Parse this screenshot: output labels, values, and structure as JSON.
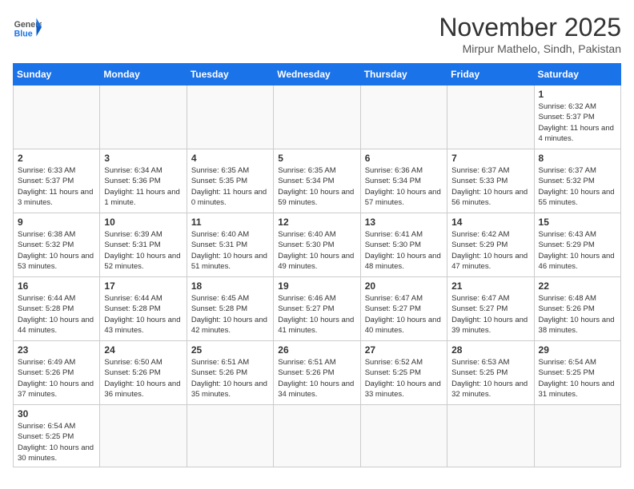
{
  "header": {
    "logo_general": "General",
    "logo_blue": "Blue",
    "month_title": "November 2025",
    "location": "Mirpur Mathelo, Sindh, Pakistan"
  },
  "days_of_week": [
    "Sunday",
    "Monday",
    "Tuesday",
    "Wednesday",
    "Thursday",
    "Friday",
    "Saturday"
  ],
  "weeks": [
    [
      {
        "day": null,
        "info": null
      },
      {
        "day": null,
        "info": null
      },
      {
        "day": null,
        "info": null
      },
      {
        "day": null,
        "info": null
      },
      {
        "day": null,
        "info": null
      },
      {
        "day": null,
        "info": null
      },
      {
        "day": "1",
        "info": "Sunrise: 6:32 AM\nSunset: 5:37 PM\nDaylight: 11 hours and 4 minutes."
      }
    ],
    [
      {
        "day": "2",
        "info": "Sunrise: 6:33 AM\nSunset: 5:37 PM\nDaylight: 11 hours and 3 minutes."
      },
      {
        "day": "3",
        "info": "Sunrise: 6:34 AM\nSunset: 5:36 PM\nDaylight: 11 hours and 1 minute."
      },
      {
        "day": "4",
        "info": "Sunrise: 6:35 AM\nSunset: 5:35 PM\nDaylight: 11 hours and 0 minutes."
      },
      {
        "day": "5",
        "info": "Sunrise: 6:35 AM\nSunset: 5:34 PM\nDaylight: 10 hours and 59 minutes."
      },
      {
        "day": "6",
        "info": "Sunrise: 6:36 AM\nSunset: 5:34 PM\nDaylight: 10 hours and 57 minutes."
      },
      {
        "day": "7",
        "info": "Sunrise: 6:37 AM\nSunset: 5:33 PM\nDaylight: 10 hours and 56 minutes."
      },
      {
        "day": "8",
        "info": "Sunrise: 6:37 AM\nSunset: 5:32 PM\nDaylight: 10 hours and 55 minutes."
      }
    ],
    [
      {
        "day": "9",
        "info": "Sunrise: 6:38 AM\nSunset: 5:32 PM\nDaylight: 10 hours and 53 minutes."
      },
      {
        "day": "10",
        "info": "Sunrise: 6:39 AM\nSunset: 5:31 PM\nDaylight: 10 hours and 52 minutes."
      },
      {
        "day": "11",
        "info": "Sunrise: 6:40 AM\nSunset: 5:31 PM\nDaylight: 10 hours and 51 minutes."
      },
      {
        "day": "12",
        "info": "Sunrise: 6:40 AM\nSunset: 5:30 PM\nDaylight: 10 hours and 49 minutes."
      },
      {
        "day": "13",
        "info": "Sunrise: 6:41 AM\nSunset: 5:30 PM\nDaylight: 10 hours and 48 minutes."
      },
      {
        "day": "14",
        "info": "Sunrise: 6:42 AM\nSunset: 5:29 PM\nDaylight: 10 hours and 47 minutes."
      },
      {
        "day": "15",
        "info": "Sunrise: 6:43 AM\nSunset: 5:29 PM\nDaylight: 10 hours and 46 minutes."
      }
    ],
    [
      {
        "day": "16",
        "info": "Sunrise: 6:44 AM\nSunset: 5:28 PM\nDaylight: 10 hours and 44 minutes."
      },
      {
        "day": "17",
        "info": "Sunrise: 6:44 AM\nSunset: 5:28 PM\nDaylight: 10 hours and 43 minutes."
      },
      {
        "day": "18",
        "info": "Sunrise: 6:45 AM\nSunset: 5:28 PM\nDaylight: 10 hours and 42 minutes."
      },
      {
        "day": "19",
        "info": "Sunrise: 6:46 AM\nSunset: 5:27 PM\nDaylight: 10 hours and 41 minutes."
      },
      {
        "day": "20",
        "info": "Sunrise: 6:47 AM\nSunset: 5:27 PM\nDaylight: 10 hours and 40 minutes."
      },
      {
        "day": "21",
        "info": "Sunrise: 6:47 AM\nSunset: 5:27 PM\nDaylight: 10 hours and 39 minutes."
      },
      {
        "day": "22",
        "info": "Sunrise: 6:48 AM\nSunset: 5:26 PM\nDaylight: 10 hours and 38 minutes."
      }
    ],
    [
      {
        "day": "23",
        "info": "Sunrise: 6:49 AM\nSunset: 5:26 PM\nDaylight: 10 hours and 37 minutes."
      },
      {
        "day": "24",
        "info": "Sunrise: 6:50 AM\nSunset: 5:26 PM\nDaylight: 10 hours and 36 minutes."
      },
      {
        "day": "25",
        "info": "Sunrise: 6:51 AM\nSunset: 5:26 PM\nDaylight: 10 hours and 35 minutes."
      },
      {
        "day": "26",
        "info": "Sunrise: 6:51 AM\nSunset: 5:26 PM\nDaylight: 10 hours and 34 minutes."
      },
      {
        "day": "27",
        "info": "Sunrise: 6:52 AM\nSunset: 5:25 PM\nDaylight: 10 hours and 33 minutes."
      },
      {
        "day": "28",
        "info": "Sunrise: 6:53 AM\nSunset: 5:25 PM\nDaylight: 10 hours and 32 minutes."
      },
      {
        "day": "29",
        "info": "Sunrise: 6:54 AM\nSunset: 5:25 PM\nDaylight: 10 hours and 31 minutes."
      }
    ],
    [
      {
        "day": "30",
        "info": "Sunrise: 6:54 AM\nSunset: 5:25 PM\nDaylight: 10 hours and 30 minutes."
      },
      {
        "day": null,
        "info": null
      },
      {
        "day": null,
        "info": null
      },
      {
        "day": null,
        "info": null
      },
      {
        "day": null,
        "info": null
      },
      {
        "day": null,
        "info": null
      },
      {
        "day": null,
        "info": null
      }
    ]
  ]
}
